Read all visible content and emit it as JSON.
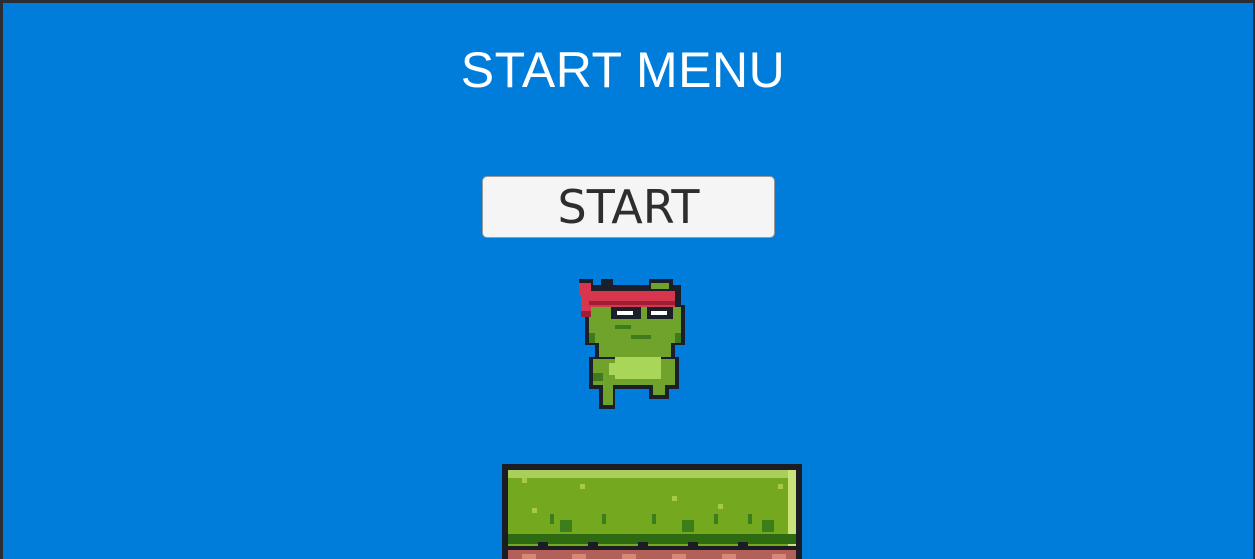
{
  "menu": {
    "title": "START MENU",
    "start_label": "START"
  },
  "colors": {
    "background": "#007cdb",
    "button_bg": "#f5f5f5",
    "title_text": "#ffffff",
    "button_text": "#2e2e2e",
    "grass": "#73a81f",
    "headband": "#d8364d"
  },
  "sprites": {
    "player": "ninja-frog-character",
    "ground": "grass-dirt-platform"
  }
}
